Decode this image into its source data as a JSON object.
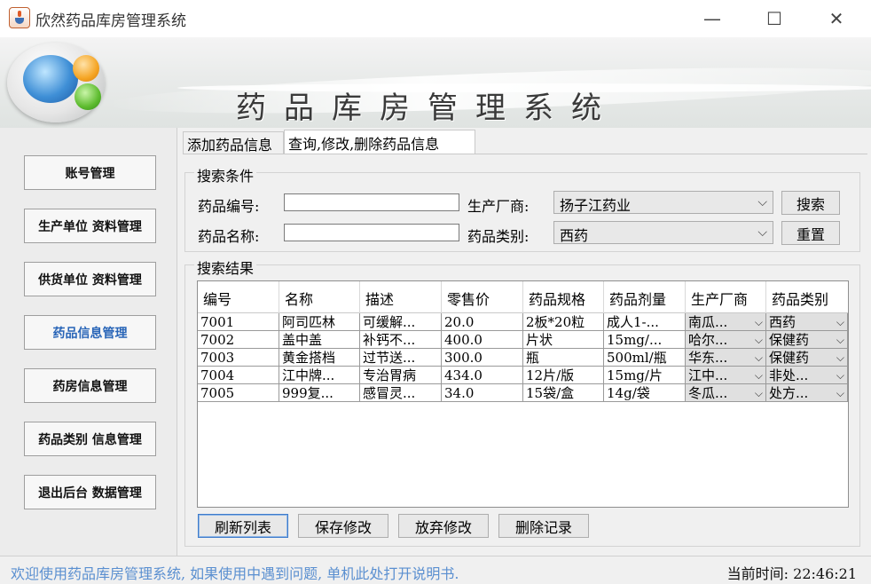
{
  "window": {
    "title": "欣然药品库房管理系统",
    "minimize_glyph": "—",
    "maximize_glyph": "☐",
    "close_glyph": "✕"
  },
  "banner": {
    "title": "药品库房管理系统"
  },
  "sidebar": {
    "items": [
      {
        "label": "账号管理"
      },
      {
        "label": "生产单位 资料管理"
      },
      {
        "label": "供货单位 资料管理"
      },
      {
        "label": "药品信息管理"
      },
      {
        "label": "药房信息管理"
      },
      {
        "label": "药品类别 信息管理"
      },
      {
        "label": "退出后台 数据管理"
      }
    ],
    "active_color": "#2a66b8"
  },
  "tabs": [
    {
      "label": "添加药品信息"
    },
    {
      "label": "查询,修改,删除药品信息"
    }
  ],
  "search": {
    "group_title": "搜索条件",
    "code_label": "药品编号:",
    "code_value": "",
    "name_label": "药品名称:",
    "name_value": "",
    "maker_label": "生产厂商:",
    "maker_value": "扬子江药业",
    "category_label": "药品类别:",
    "category_value": "西药",
    "search_button": "搜索",
    "reset_button": "重置"
  },
  "results": {
    "group_title": "搜索结果",
    "columns": [
      "编号",
      "名称",
      "描述",
      "零售价",
      "药品规格",
      "药品剂量",
      "生产厂商",
      "药品类别"
    ],
    "rows": [
      [
        "7001",
        "阿司匹林",
        "可缓解...",
        "20.0",
        "2板*20粒",
        "成人1-...",
        "南瓜...",
        "西药"
      ],
      [
        "7002",
        "盖中盖",
        "补钙不...",
        "400.0",
        "片状",
        "15mg/...",
        "哈尔...",
        "保健药"
      ],
      [
        "7003",
        "黄金搭档",
        "过节送...",
        "300.0",
        "瓶",
        "500ml/瓶",
        "华东...",
        "保健药"
      ],
      [
        "7004",
        "江中牌...",
        "专治胃病",
        "434.0",
        "12片/版",
        "15mg/片",
        "江中...",
        "非处..."
      ],
      [
        "7005",
        "999复...",
        "感冒灵...",
        "34.0",
        "15袋/盒",
        "14g/袋",
        "冬瓜...",
        "处方..."
      ]
    ]
  },
  "actions": {
    "refresh": "刷新列表",
    "save": "保存修改",
    "discard": "放弃修改",
    "delete": "删除记录"
  },
  "status": {
    "message": "欢迎使用药品库房管理系统, 如果使用中遇到问题, 单机此处打开说明书.",
    "time_label": "当前时间:",
    "time_value": "22:46:21"
  }
}
